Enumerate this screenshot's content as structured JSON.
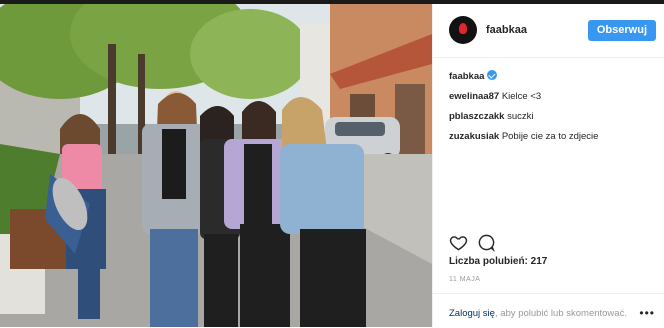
{
  "post": {
    "author": "faabkaa",
    "follow_label": "Obserwuj"
  },
  "comments": [
    {
      "user": "faabkaa",
      "text": "",
      "verified_icon": "blue-heart-icon"
    },
    {
      "user": "ewelinaa87",
      "text": "Kielce <3"
    },
    {
      "user": "pblaszczakk",
      "text": "suczki"
    },
    {
      "user": "zuzakusiak",
      "text": "Pobije cie za to zdjecie"
    }
  ],
  "actions": {
    "like_icon": "heart-icon",
    "comment_icon": "comment-icon"
  },
  "likes_text": "Liczba polubień: 217",
  "date_text": "11 MAJA",
  "footer": {
    "login_link": "Zaloguj się",
    "login_rest": ", aby polubić lub skomentować.",
    "more_icon": "ellipsis-icon",
    "more_label": "•••"
  },
  "colors": {
    "accent": "#3897f0",
    "text": "#262626",
    "muted": "#999999",
    "link": "#003569"
  },
  "photo": {
    "description_icon": "photo-image",
    "scene": "group of five girls posing on a tree-lined sidewalk"
  }
}
